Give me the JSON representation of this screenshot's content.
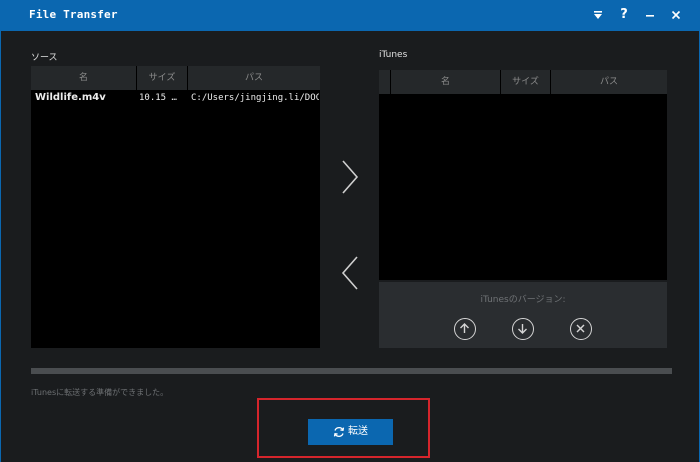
{
  "window": {
    "title": "File Transfer"
  },
  "titlebar": {
    "help_label": "?"
  },
  "source": {
    "label": "ソース",
    "columns": [
      "名",
      "サイズ",
      "パス"
    ],
    "rows": [
      {
        "name": "Wildlife.m4v",
        "size": "10.15 …",
        "path": "C:/Users/jingjing.li/DOC…"
      }
    ]
  },
  "itunes": {
    "label": "iTunes",
    "columns": [
      "名",
      "サイズ",
      "パス"
    ],
    "version_text": "iTunesのバージョン:"
  },
  "progress": {
    "fraction": 0
  },
  "status": {
    "text": "iTunesに転送する準備ができました。"
  },
  "transfer": {
    "label": "転送"
  },
  "colors": {
    "accent": "#0b67b0",
    "highlight": "#d6252c"
  }
}
